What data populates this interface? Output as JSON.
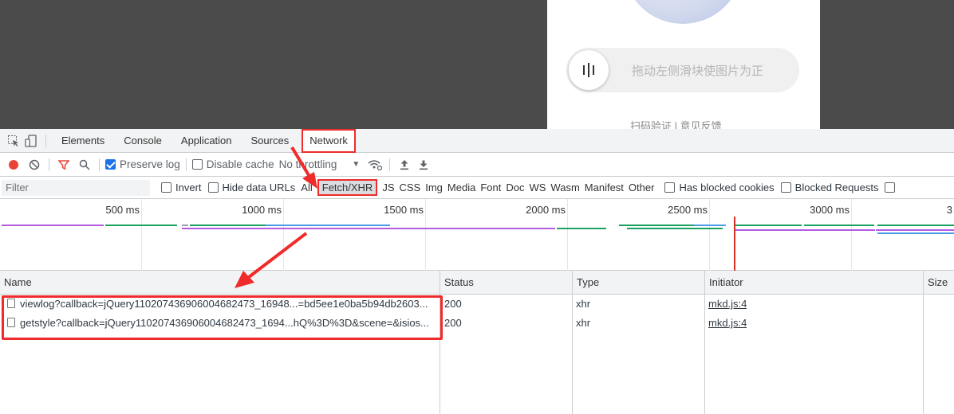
{
  "captcha": {
    "slider_hint": "拖动左侧滑块使图片为正",
    "footer_links": "扫码验证  |  意见反馈"
  },
  "devtools": {
    "tabs": [
      "Elements",
      "Console",
      "Application",
      "Sources",
      "Network"
    ],
    "active_tab": "Network",
    "toolbar": {
      "preserve_log": "Preserve log",
      "disable_cache": "Disable cache",
      "throttling": "No throttling"
    },
    "filter": {
      "placeholder": "Filter",
      "invert": "Invert",
      "hide_data_urls": "Hide data URLs",
      "types": [
        "All",
        "Fetch/XHR",
        "JS",
        "CSS",
        "Img",
        "Media",
        "Font",
        "Doc",
        "WS",
        "Wasm",
        "Manifest",
        "Other"
      ],
      "selected_type": "Fetch/XHR",
      "has_blocked_cookies": "Has blocked cookies",
      "blocked_requests": "Blocked Requests"
    },
    "timeline": {
      "ticks": [
        "500 ms",
        "1000 ms",
        "1500 ms",
        "2000 ms",
        "2500 ms",
        "3000 ms",
        "3"
      ]
    },
    "table": {
      "columns": [
        "Name",
        "Status",
        "Type",
        "Initiator",
        "Size"
      ],
      "rows": [
        {
          "name": "viewlog?callback=jQuery110207436906004682473_16948...=bd5ee1e0ba5b94db2603...",
          "status": "200",
          "type": "xhr",
          "initiator": "mkd.js:4"
        },
        {
          "name": "getstyle?callback=jQuery110207436906004682473_1694...hQ%3D%3D&scene=&isios...",
          "status": "200",
          "type": "xhr",
          "initiator": "mkd.js:4"
        }
      ]
    }
  },
  "colors": {
    "highlight": "#ef2b2b",
    "record": "#ea4335",
    "checkbox": "#1a73e8"
  }
}
